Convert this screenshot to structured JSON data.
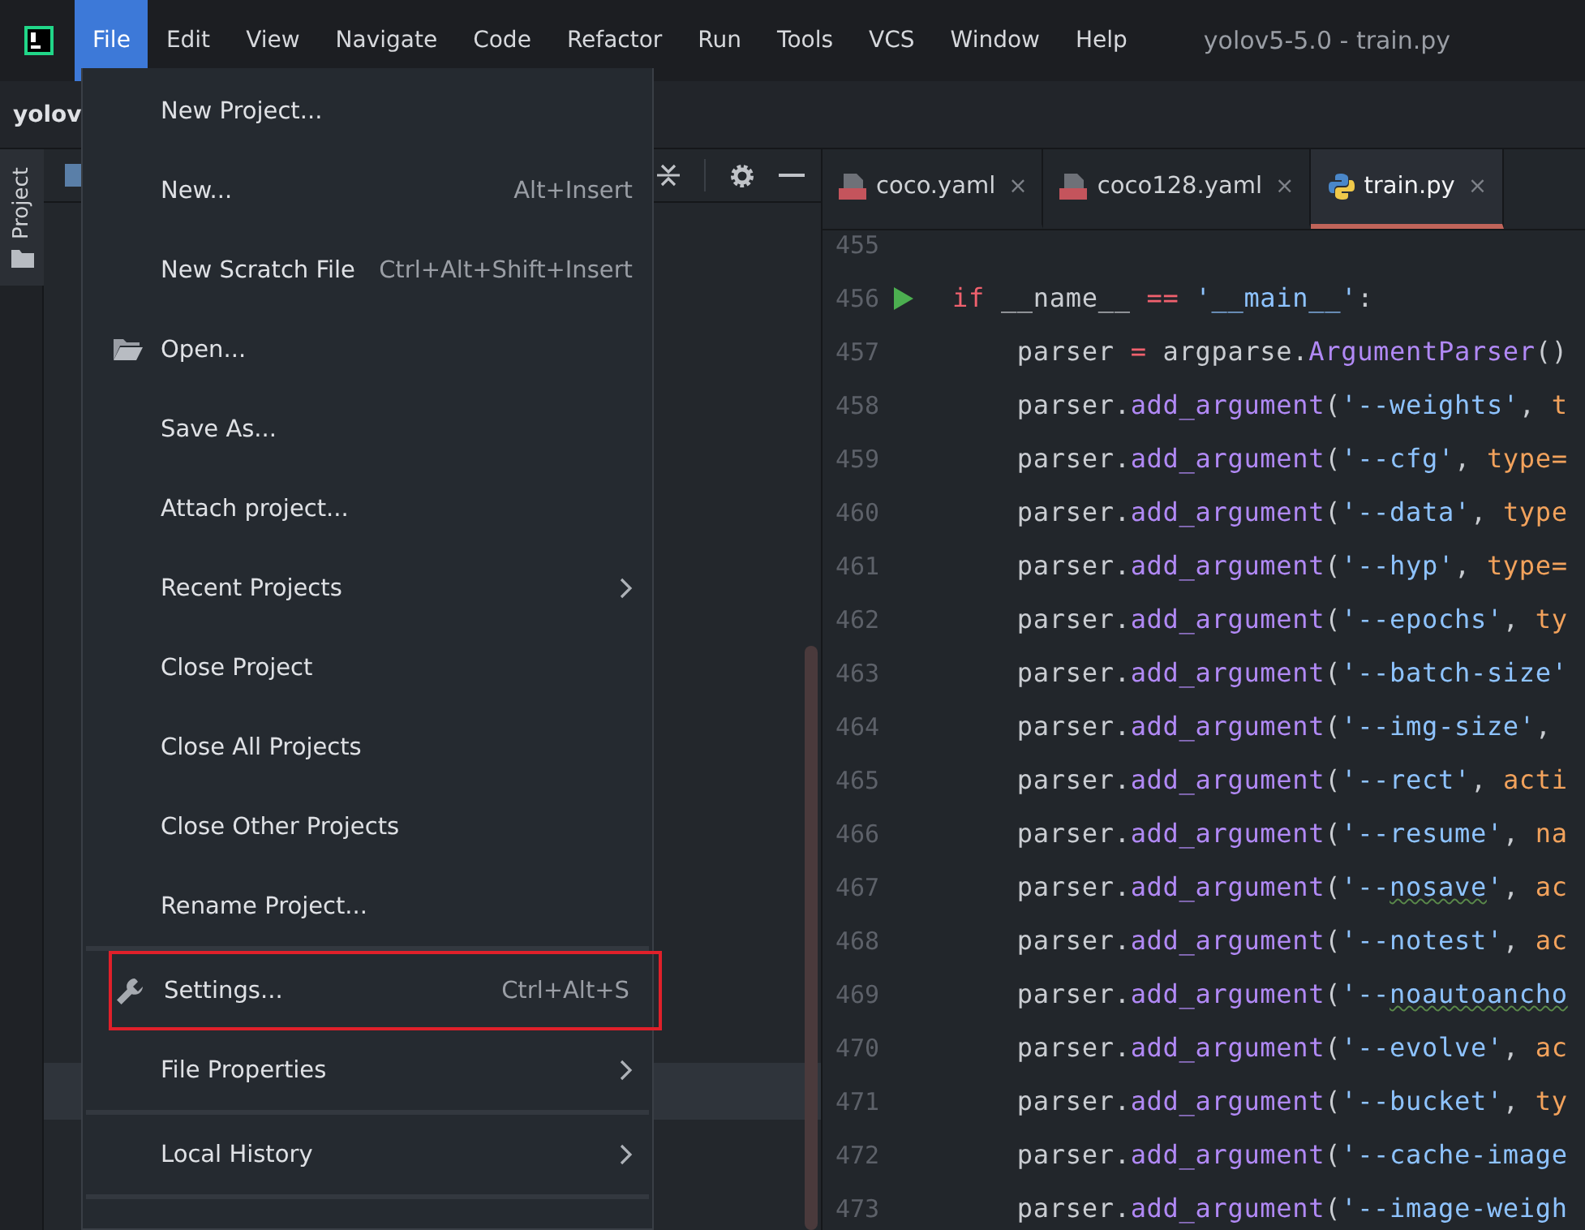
{
  "window": {
    "title": "yolov5-5.0 - train.py"
  },
  "menubar": [
    {
      "label": "File",
      "selected": true
    },
    {
      "label": "Edit",
      "selected": false
    },
    {
      "label": "View",
      "selected": false
    },
    {
      "label": "Navigate",
      "selected": false
    },
    {
      "label": "Code",
      "selected": false
    },
    {
      "label": "Refactor",
      "selected": false
    },
    {
      "label": "Run",
      "selected": false
    },
    {
      "label": "Tools",
      "selected": false
    },
    {
      "label": "VCS",
      "selected": false
    },
    {
      "label": "Window",
      "selected": false
    },
    {
      "label": "Help",
      "selected": false
    }
  ],
  "breadcrumb": "yolov",
  "tool_window_tab": {
    "label": "Project"
  },
  "file_menu": [
    {
      "kind": "item",
      "label": "New Project...",
      "highlighted": false
    },
    {
      "kind": "item",
      "label": "New...",
      "shortcut": "Alt+Insert",
      "highlighted": false
    },
    {
      "kind": "item",
      "label": "New Scratch File",
      "shortcut": "Ctrl+Alt+Shift+Insert",
      "highlighted": false
    },
    {
      "kind": "folder",
      "label": "Open...",
      "highlighted": false
    },
    {
      "kind": "item",
      "label": "Save As...",
      "highlighted": false
    },
    {
      "kind": "item",
      "label": "Attach project...",
      "highlighted": false
    },
    {
      "kind": "item",
      "label": "Recent Projects",
      "submenu": true,
      "highlighted": false
    },
    {
      "kind": "item",
      "label": "Close Project",
      "highlighted": false
    },
    {
      "kind": "item",
      "label": "Close All Projects",
      "highlighted": false
    },
    {
      "kind": "item",
      "label": "Close Other Projects",
      "highlighted": false
    },
    {
      "kind": "item",
      "label": "Rename Project...",
      "highlighted": false
    },
    {
      "kind": "separator"
    },
    {
      "kind": "wrench",
      "label": "Settings...",
      "shortcut": "Ctrl+Alt+S",
      "highlighted": true
    },
    {
      "kind": "item",
      "label": "File Properties",
      "submenu": true,
      "highlighted": false
    },
    {
      "kind": "separator"
    },
    {
      "kind": "item",
      "label": "Local History",
      "submenu": true,
      "highlighted": false
    },
    {
      "kind": "separator"
    }
  ],
  "editor_tabs": [
    {
      "kind": "yaml",
      "label": "coco.yaml",
      "close": "×",
      "selected": false
    },
    {
      "kind": "yaml",
      "label": "coco128.yaml",
      "close": "×",
      "selected": false
    },
    {
      "kind": "python",
      "label": "train.py",
      "close": "×",
      "selected": true
    }
  ],
  "code_lines": [
    {
      "number": "455",
      "run": false
    },
    {
      "number": "456",
      "run": true,
      "tokens": [
        {
          "kind": "keyword",
          "text": "if"
        },
        {
          "kind": "plain",
          "text": " __name__ "
        },
        {
          "kind": "keyword",
          "text": "=="
        },
        {
          "kind": "string",
          "text": " '__main__'"
        },
        {
          "kind": "plain",
          "text": ":"
        }
      ]
    },
    {
      "number": "457",
      "run": false,
      "tokens": [
        {
          "kind": "plain",
          "text": "    parser "
        },
        {
          "kind": "keyword",
          "text": "="
        },
        {
          "kind": "plain",
          "text": " argparse."
        },
        {
          "kind": "func",
          "text": "ArgumentParser"
        },
        {
          "kind": "plain",
          "text": "()"
        }
      ]
    },
    {
      "number": "458",
      "run": false,
      "tokens": [
        {
          "kind": "plain",
          "text": "    parser."
        },
        {
          "kind": "func",
          "text": "add_argument"
        },
        {
          "kind": "plain",
          "text": "("
        },
        {
          "kind": "string",
          "text": "'--weights'"
        },
        {
          "kind": "plain",
          "text": ", "
        },
        {
          "kind": "param",
          "text": "t"
        }
      ]
    },
    {
      "number": "459",
      "run": false,
      "tokens": [
        {
          "kind": "plain",
          "text": "    parser."
        },
        {
          "kind": "func",
          "text": "add_argument"
        },
        {
          "kind": "plain",
          "text": "("
        },
        {
          "kind": "string",
          "text": "'--cfg'"
        },
        {
          "kind": "plain",
          "text": ", "
        },
        {
          "kind": "param",
          "text": "type="
        }
      ]
    },
    {
      "number": "460",
      "run": false,
      "tokens": [
        {
          "kind": "plain",
          "text": "    parser."
        },
        {
          "kind": "func",
          "text": "add_argument"
        },
        {
          "kind": "plain",
          "text": "("
        },
        {
          "kind": "string",
          "text": "'--data'"
        },
        {
          "kind": "plain",
          "text": ", "
        },
        {
          "kind": "param",
          "text": "type"
        }
      ]
    },
    {
      "number": "461",
      "run": false,
      "tokens": [
        {
          "kind": "plain",
          "text": "    parser."
        },
        {
          "kind": "func",
          "text": "add_argument"
        },
        {
          "kind": "plain",
          "text": "("
        },
        {
          "kind": "string",
          "text": "'--hyp'"
        },
        {
          "kind": "plain",
          "text": ", "
        },
        {
          "kind": "param",
          "text": "type="
        }
      ]
    },
    {
      "number": "462",
      "run": false,
      "tokens": [
        {
          "kind": "plain",
          "text": "    parser."
        },
        {
          "kind": "func",
          "text": "add_argument"
        },
        {
          "kind": "plain",
          "text": "("
        },
        {
          "kind": "string",
          "text": "'--epochs'"
        },
        {
          "kind": "plain",
          "text": ", "
        },
        {
          "kind": "param",
          "text": "ty"
        }
      ]
    },
    {
      "number": "463",
      "run": false,
      "tokens": [
        {
          "kind": "plain",
          "text": "    parser."
        },
        {
          "kind": "func",
          "text": "add_argument"
        },
        {
          "kind": "plain",
          "text": "("
        },
        {
          "kind": "string",
          "text": "'--batch-size'"
        }
      ]
    },
    {
      "number": "464",
      "run": false,
      "tokens": [
        {
          "kind": "plain",
          "text": "    parser."
        },
        {
          "kind": "func",
          "text": "add_argument"
        },
        {
          "kind": "plain",
          "text": "("
        },
        {
          "kind": "string",
          "text": "'--img-size'"
        },
        {
          "kind": "plain",
          "text": ","
        }
      ]
    },
    {
      "number": "465",
      "run": false,
      "tokens": [
        {
          "kind": "plain",
          "text": "    parser."
        },
        {
          "kind": "func",
          "text": "add_argument"
        },
        {
          "kind": "plain",
          "text": "("
        },
        {
          "kind": "string",
          "text": "'--rect'"
        },
        {
          "kind": "plain",
          "text": ", "
        },
        {
          "kind": "param",
          "text": "acti"
        }
      ]
    },
    {
      "number": "466",
      "run": false,
      "tokens": [
        {
          "kind": "plain",
          "text": "    parser."
        },
        {
          "kind": "func",
          "text": "add_argument"
        },
        {
          "kind": "plain",
          "text": "("
        },
        {
          "kind": "string",
          "text": "'--resume'"
        },
        {
          "kind": "plain",
          "text": ", "
        },
        {
          "kind": "param",
          "text": "na"
        }
      ]
    },
    {
      "number": "467",
      "run": false,
      "tokens": [
        {
          "kind": "plain",
          "text": "    parser."
        },
        {
          "kind": "func",
          "text": "add_argument"
        },
        {
          "kind": "plain",
          "text": "("
        },
        {
          "kind": "string",
          "text": "'--"
        },
        {
          "kind": "typo",
          "text": "nosave"
        },
        {
          "kind": "string",
          "text": "'"
        },
        {
          "kind": "plain",
          "text": ", "
        },
        {
          "kind": "param",
          "text": "ac"
        }
      ]
    },
    {
      "number": "468",
      "run": false,
      "tokens": [
        {
          "kind": "plain",
          "text": "    parser."
        },
        {
          "kind": "func",
          "text": "add_argument"
        },
        {
          "kind": "plain",
          "text": "("
        },
        {
          "kind": "string",
          "text": "'--notest'"
        },
        {
          "kind": "plain",
          "text": ", "
        },
        {
          "kind": "param",
          "text": "ac"
        }
      ]
    },
    {
      "number": "469",
      "run": false,
      "tokens": [
        {
          "kind": "plain",
          "text": "    parser."
        },
        {
          "kind": "func",
          "text": "add_argument"
        },
        {
          "kind": "plain",
          "text": "("
        },
        {
          "kind": "string",
          "text": "'--"
        },
        {
          "kind": "typo",
          "text": "noautoancho"
        }
      ]
    },
    {
      "number": "470",
      "run": false,
      "tokens": [
        {
          "kind": "plain",
          "text": "    parser."
        },
        {
          "kind": "func",
          "text": "add_argument"
        },
        {
          "kind": "plain",
          "text": "("
        },
        {
          "kind": "string",
          "text": "'--evolve'"
        },
        {
          "kind": "plain",
          "text": ", "
        },
        {
          "kind": "param",
          "text": "ac"
        }
      ]
    },
    {
      "number": "471",
      "run": false,
      "tokens": [
        {
          "kind": "plain",
          "text": "    parser."
        },
        {
          "kind": "func",
          "text": "add_argument"
        },
        {
          "kind": "plain",
          "text": "("
        },
        {
          "kind": "string",
          "text": "'--bucket'"
        },
        {
          "kind": "plain",
          "text": ", "
        },
        {
          "kind": "param",
          "text": "ty"
        }
      ]
    },
    {
      "number": "472",
      "run": false,
      "tokens": [
        {
          "kind": "plain",
          "text": "    parser."
        },
        {
          "kind": "func",
          "text": "add_argument"
        },
        {
          "kind": "plain",
          "text": "("
        },
        {
          "kind": "string",
          "text": "'--cache-image"
        }
      ]
    },
    {
      "number": "473",
      "run": false,
      "tokens": [
        {
          "kind": "plain",
          "text": "    parser."
        },
        {
          "kind": "func",
          "text": "add_argument"
        },
        {
          "kind": "plain",
          "text": "("
        },
        {
          "kind": "string",
          "text": "'--image-weigh"
        }
      ]
    }
  ]
}
